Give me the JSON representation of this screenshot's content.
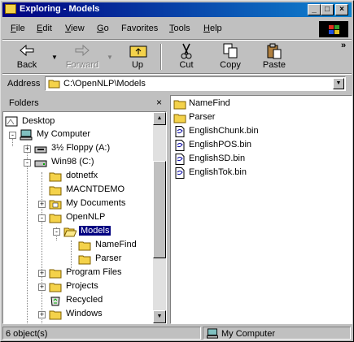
{
  "window": {
    "title": "Exploring - Models"
  },
  "title_buttons": {
    "minimize": "_",
    "maximize": "□",
    "close": "×"
  },
  "menu": [
    {
      "key": "F",
      "rest": "ile"
    },
    {
      "key": "E",
      "rest": "dit"
    },
    {
      "key": "V",
      "rest": "iew"
    },
    {
      "key": "G",
      "rest": "o"
    },
    {
      "key": "",
      "pre": "F",
      "rest": "avorites"
    },
    {
      "key": "T",
      "rest": "ools"
    },
    {
      "key": "H",
      "rest": "elp"
    }
  ],
  "toolbar": {
    "back": "Back",
    "forward": "Forward",
    "up": "Up",
    "cut": "Cut",
    "copy": "Copy",
    "paste": "Paste",
    "overflow": "»"
  },
  "address": {
    "label": "Address",
    "value": "C:\\OpenNLP\\Models"
  },
  "folders_pane": {
    "title": "Folders",
    "close": "×"
  },
  "tree": [
    "Desktop",
    "My Computer",
    "3½ Floppy (A:)",
    "Win98 (C:)",
    "dotnetfx",
    "MACNTDEMO",
    "My Documents",
    "OpenNLP",
    "Models",
    "NameFind",
    "Parser",
    "Program Files",
    "Projects",
    "Recycled",
    "Windows"
  ],
  "files": [
    {
      "name": "NameFind",
      "type": "folder"
    },
    {
      "name": "Parser",
      "type": "folder"
    },
    {
      "name": "EnglishChunk.bin",
      "type": "file"
    },
    {
      "name": "EnglishPOS.bin",
      "type": "file"
    },
    {
      "name": "EnglishSD.bin",
      "type": "file"
    },
    {
      "name": "EnglishTok.bin",
      "type": "file"
    }
  ],
  "status": {
    "count": "6 object(s)",
    "location": "My Computer"
  },
  "colors": {
    "titlebar_start": "#000080",
    "titlebar_end": "#1084d0",
    "selection": "#000080",
    "face": "#c0c0c0"
  }
}
